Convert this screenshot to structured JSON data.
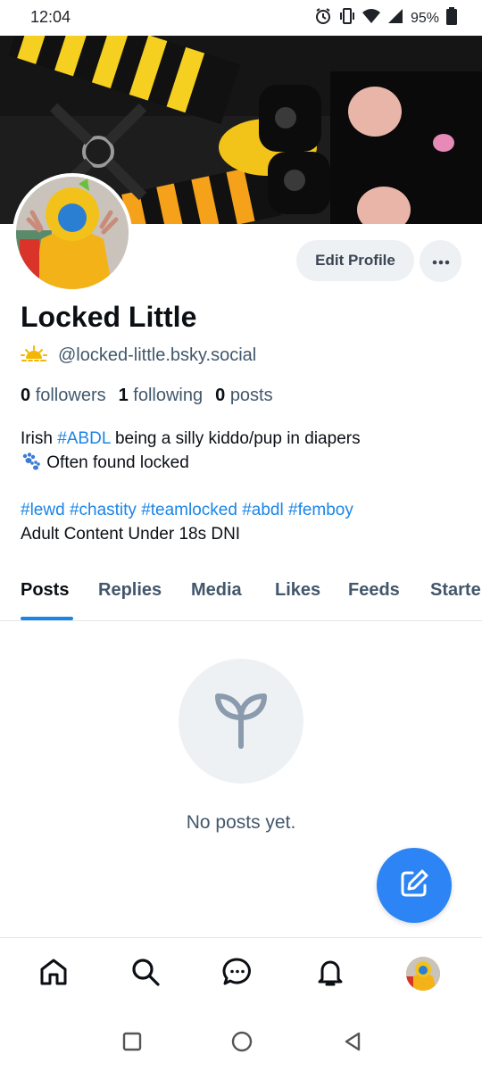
{
  "status_bar": {
    "time": "12:04",
    "battery": "95%",
    "icons": [
      "alarm-icon",
      "vibrate-icon",
      "wifi-icon",
      "signal-icon",
      "battery-icon"
    ]
  },
  "profile": {
    "display_name": "Locked Little",
    "handle": "@locked-little.bsky.social",
    "handle_icon": "sunrise-icon",
    "edit_button": "Edit Profile",
    "more_button": "more-options-icon",
    "stats": {
      "followers_count": "0",
      "followers_label": "followers",
      "following_count": "1",
      "following_label": "following",
      "posts_count": "0",
      "posts_label": "posts"
    },
    "bio": {
      "line1_pre": "Irish ",
      "line1_tag": "#ABDL",
      "line1_post": " being a silly kiddo/pup in diapers",
      "line2_icon": "paw-prints-icon",
      "line2_text": " Often found locked",
      "tags": [
        "#lewd",
        "#chastity",
        "#teamlocked",
        "#abdl",
        "#femboy"
      ],
      "line4": "Adult Content Under 18s DNI"
    }
  },
  "tabs": [
    "Posts",
    "Replies",
    "Media",
    "Likes",
    "Feeds",
    "Starte"
  ],
  "active_tab": "Posts",
  "empty_state": {
    "icon": "sprout-icon",
    "text": "No posts yet."
  },
  "fab": {
    "icon": "compose-icon"
  },
  "bottom_nav": [
    "home-icon",
    "search-icon",
    "chat-icon",
    "bell-icon",
    "profile-avatar"
  ],
  "system_nav": [
    "recents-icon",
    "home-circle-icon",
    "back-icon"
  ],
  "colors": {
    "accent": "#1b85e6",
    "fab": "#2c84f5",
    "muted_text": "#42576c",
    "button_bg": "#eef1f4"
  }
}
